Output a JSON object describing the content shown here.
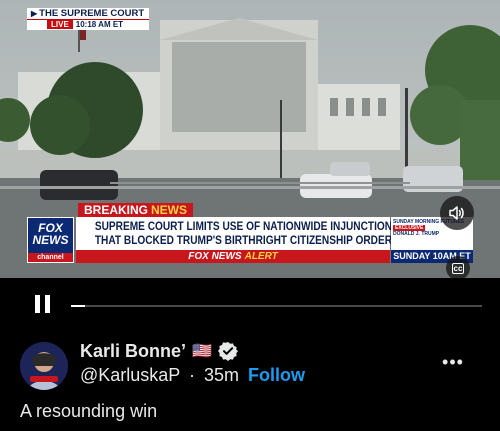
{
  "video": {
    "bug_title": "THE SUPREME COURT",
    "bug_live": "LIVE",
    "bug_time": "10:18 AM ET",
    "breaking": "BREAKING",
    "breaking_news": "NEWS",
    "headline_line1": "SUPREME COURT LIMITS USE OF NATIONWIDE INJUNCTION",
    "headline_line2": "THAT BLOCKED TRUMP'S BIRTHRIGHT CITIZENSHIP ORDER",
    "network_fox": "FOX",
    "network_news": "NEWS",
    "network_channel": "channel",
    "alert_prefix": "FOX NEWS",
    "alert_word": "ALERT",
    "promo_show": "SUNDAY MORNING FUTURES",
    "promo_exclusive": "EXCLUSIVE",
    "promo_guest": "DONALD J. TRUMP",
    "promo_time": "SUNDAY 10AM ET",
    "progress_fraction": 0.035,
    "colors": {
      "fox_red": "#c8161d",
      "fox_blue": "#0b2a73",
      "alert_yellow": "#ffd23f"
    }
  },
  "controls": {
    "volume_icon": "speaker-icon",
    "captions_icon": "closed-captions-icon",
    "pause_icon": "pause-icon"
  },
  "post": {
    "author_name": "Karli Bonne’",
    "flag": "🇺🇸",
    "handle": "@KarluskaP",
    "separator": "·",
    "age": "35m",
    "follow_label": "Follow",
    "more_label": "•••",
    "text": "A resounding win",
    "accent": "#1d9bf0"
  }
}
